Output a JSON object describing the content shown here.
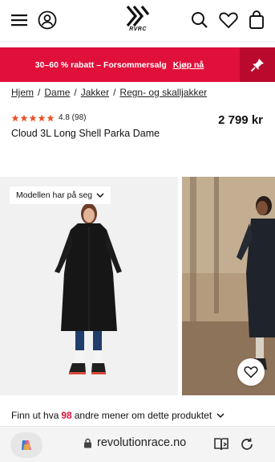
{
  "header": {
    "logo_text": "RVRC",
    "icons": [
      "menu-icon",
      "account-icon",
      "search-icon",
      "wishlist-icon",
      "cart-icon"
    ]
  },
  "promo": {
    "text": "30–60 % rabatt – Forsommersalg",
    "link": "Kjøp nå",
    "background": "#e0103a"
  },
  "breadcrumb": {
    "items": [
      "Hjem",
      "Dame",
      "Jakker",
      "Regn- og skalljakker"
    ],
    "separator": "/"
  },
  "product": {
    "stars": 5,
    "rating_text": "4.8 (98)",
    "name": "Cloud 3L Long Shell Parka Dame",
    "price": "2 799 kr"
  },
  "gallery": {
    "model_button": "Modellen har på seg"
  },
  "reviews": {
    "prefix": "Finn ut hva",
    "count": "98",
    "suffix": "andre mener om dette produktet"
  },
  "browser": {
    "url": "revolutionrace.no"
  },
  "colors": {
    "accent": "#e0103a",
    "star": "#e8552a"
  }
}
